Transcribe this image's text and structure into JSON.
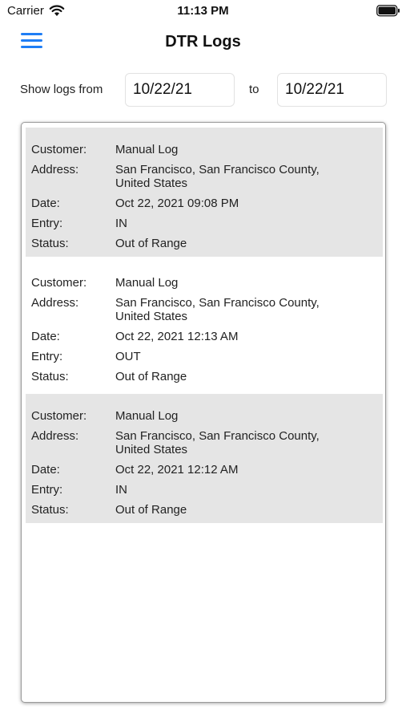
{
  "status_bar": {
    "carrier": "Carrier",
    "time": "11:13 PM"
  },
  "header": {
    "title": "DTR Logs",
    "menu_icon": "hamburger-menu-icon",
    "accent_color": "#1f7ef5"
  },
  "filter": {
    "label": "Show logs from",
    "from_date": "10/22/21",
    "to_label": "to",
    "to_date": "10/22/21"
  },
  "field_labels": {
    "customer": "Customer:",
    "address": "Address:",
    "date": "Date:",
    "entry": "Entry:",
    "status": "Status:"
  },
  "logs": [
    {
      "customer": "Manual Log",
      "address_line1": "San Francisco, San Francisco County,",
      "address_line2": "United States",
      "date": "Oct 22, 2021 09:08 PM",
      "entry": "IN",
      "status": "Out of Range"
    },
    {
      "customer": "Manual Log",
      "address_line1": "San Francisco, San Francisco County,",
      "address_line2": "United States",
      "date": "Oct 22, 2021 12:13 AM",
      "entry": "OUT",
      "status": "Out of Range"
    },
    {
      "customer": "Manual Log",
      "address_line1": "San Francisco, San Francisco County,",
      "address_line2": "United States",
      "date": "Oct 22, 2021 12:12 AM",
      "entry": "IN",
      "status": "Out of Range"
    }
  ]
}
